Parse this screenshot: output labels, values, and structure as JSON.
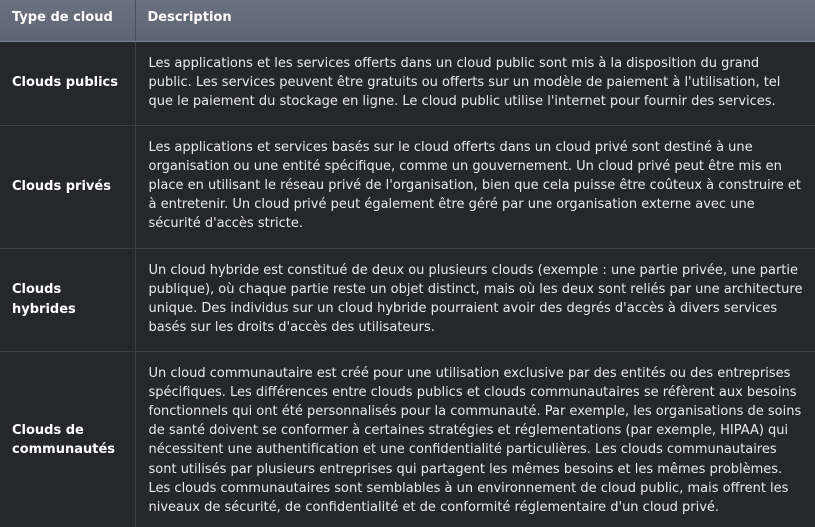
{
  "table": {
    "headers": {
      "type": "Type de cloud",
      "description": "Description"
    },
    "rows": [
      {
        "type": "Clouds publics",
        "description": "Les applications et les services offerts dans un cloud public sont mis à la disposition du grand public. Les services peuvent être gratuits ou offerts sur un modèle de paiement à l'utilisation, tel que le paiement du stockage en ligne. Le cloud public utilise l'internet pour fournir des services."
      },
      {
        "type": "Clouds privés",
        "description": "Les applications et services basés sur le cloud offerts dans un cloud privé sont destiné à une organisation ou une entité spécifique, comme un gouvernement. Un cloud privé peut être mis en place en utilisant le réseau privé de l'organisation, bien que cela puisse être coûteux à construire et à entretenir. Un cloud privé peut également être géré par une organisation externe avec une sécurité d'accès stricte."
      },
      {
        "type": "Clouds hybrides",
        "description": "Un cloud hybride est constitué de deux ou plusieurs clouds (exemple : une partie privée, une partie publique), où chaque partie reste un objet distinct, mais où les deux sont reliés par une architecture unique. Des individus sur un cloud hybride pourraient avoir des degrés d'accès à divers services basés sur les droits d'accès des utilisateurs."
      },
      {
        "type": "Clouds de communautés",
        "description": "Un cloud communautaire est créé pour une utilisation exclusive par des entités ou des entreprises spécifiques. Les différences entre clouds publics et clouds communautaires se réfèrent aux besoins fonctionnels qui ont été personnalisés pour la communauté. Par exemple, les organisations de soins de santé doivent se conformer à certaines stratégies et réglementations (par exemple, HIPAA) qui nécessitent une authentification et une confidentialité particulières. Les clouds communautaires sont utilisés par plusieurs entreprises qui partagent les mêmes besoins et les mêmes problèmes. Les clouds communautaires sont semblables à un environnement de cloud public, mais offrent les niveaux de sécurité, de confidentialité et de conformité réglementaire d'un cloud privé."
      }
    ]
  }
}
